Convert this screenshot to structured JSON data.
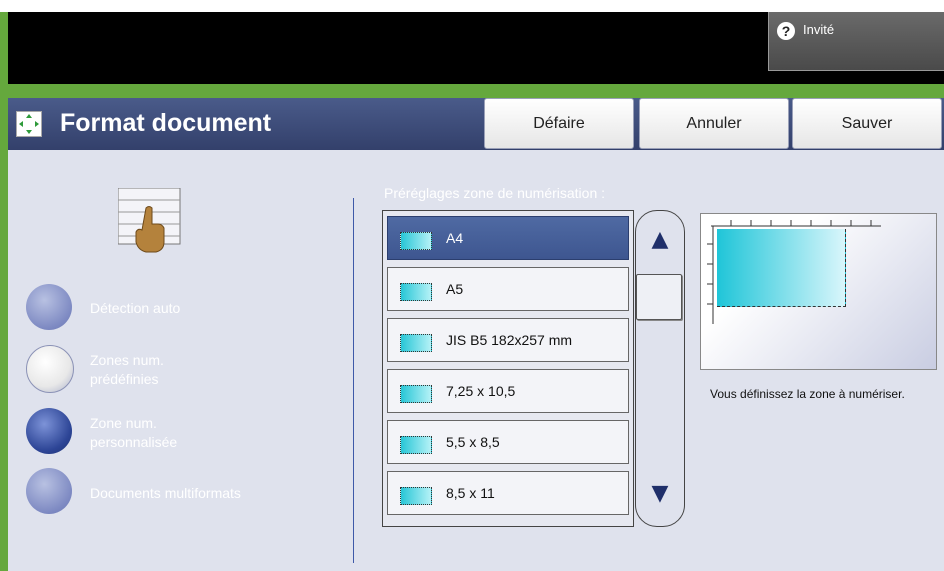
{
  "header": {
    "guest_label": "Invité",
    "help_icon": "question-icon"
  },
  "titlebar": {
    "title": "Format document",
    "icon": "resize-arrows-icon",
    "buttons": [
      {
        "label": "Défaire"
      },
      {
        "label": "Annuler"
      },
      {
        "label": "Sauver"
      }
    ]
  },
  "left_panel": {
    "options": [
      {
        "label": "Détection auto",
        "state": "unselected"
      },
      {
        "label": "Zones num. prédéfinies",
        "state": "highlighted"
      },
      {
        "label": "Zone num. personnalisée",
        "state": "selected"
      },
      {
        "label": "Documents multiformats",
        "state": "unselected"
      }
    ]
  },
  "presets": {
    "label": "Préréglages zone de numérisation :",
    "items": [
      {
        "label": "A4",
        "selected": true
      },
      {
        "label": "A5",
        "selected": false
      },
      {
        "label": "JIS B5 182x257 mm",
        "selected": false
      },
      {
        "label": "7,25 x 10,5",
        "selected": false
      },
      {
        "label": "5,5 x 8,5",
        "selected": false
      },
      {
        "label": "8,5 x 11",
        "selected": false
      }
    ]
  },
  "preview": {
    "help_text": "Vous définissez la zone à numériser."
  },
  "colors": {
    "frame": "#65a83d",
    "titlebar": "#33406b",
    "panel": "#dfe2ed",
    "selected_item": "#4f6aa3"
  }
}
